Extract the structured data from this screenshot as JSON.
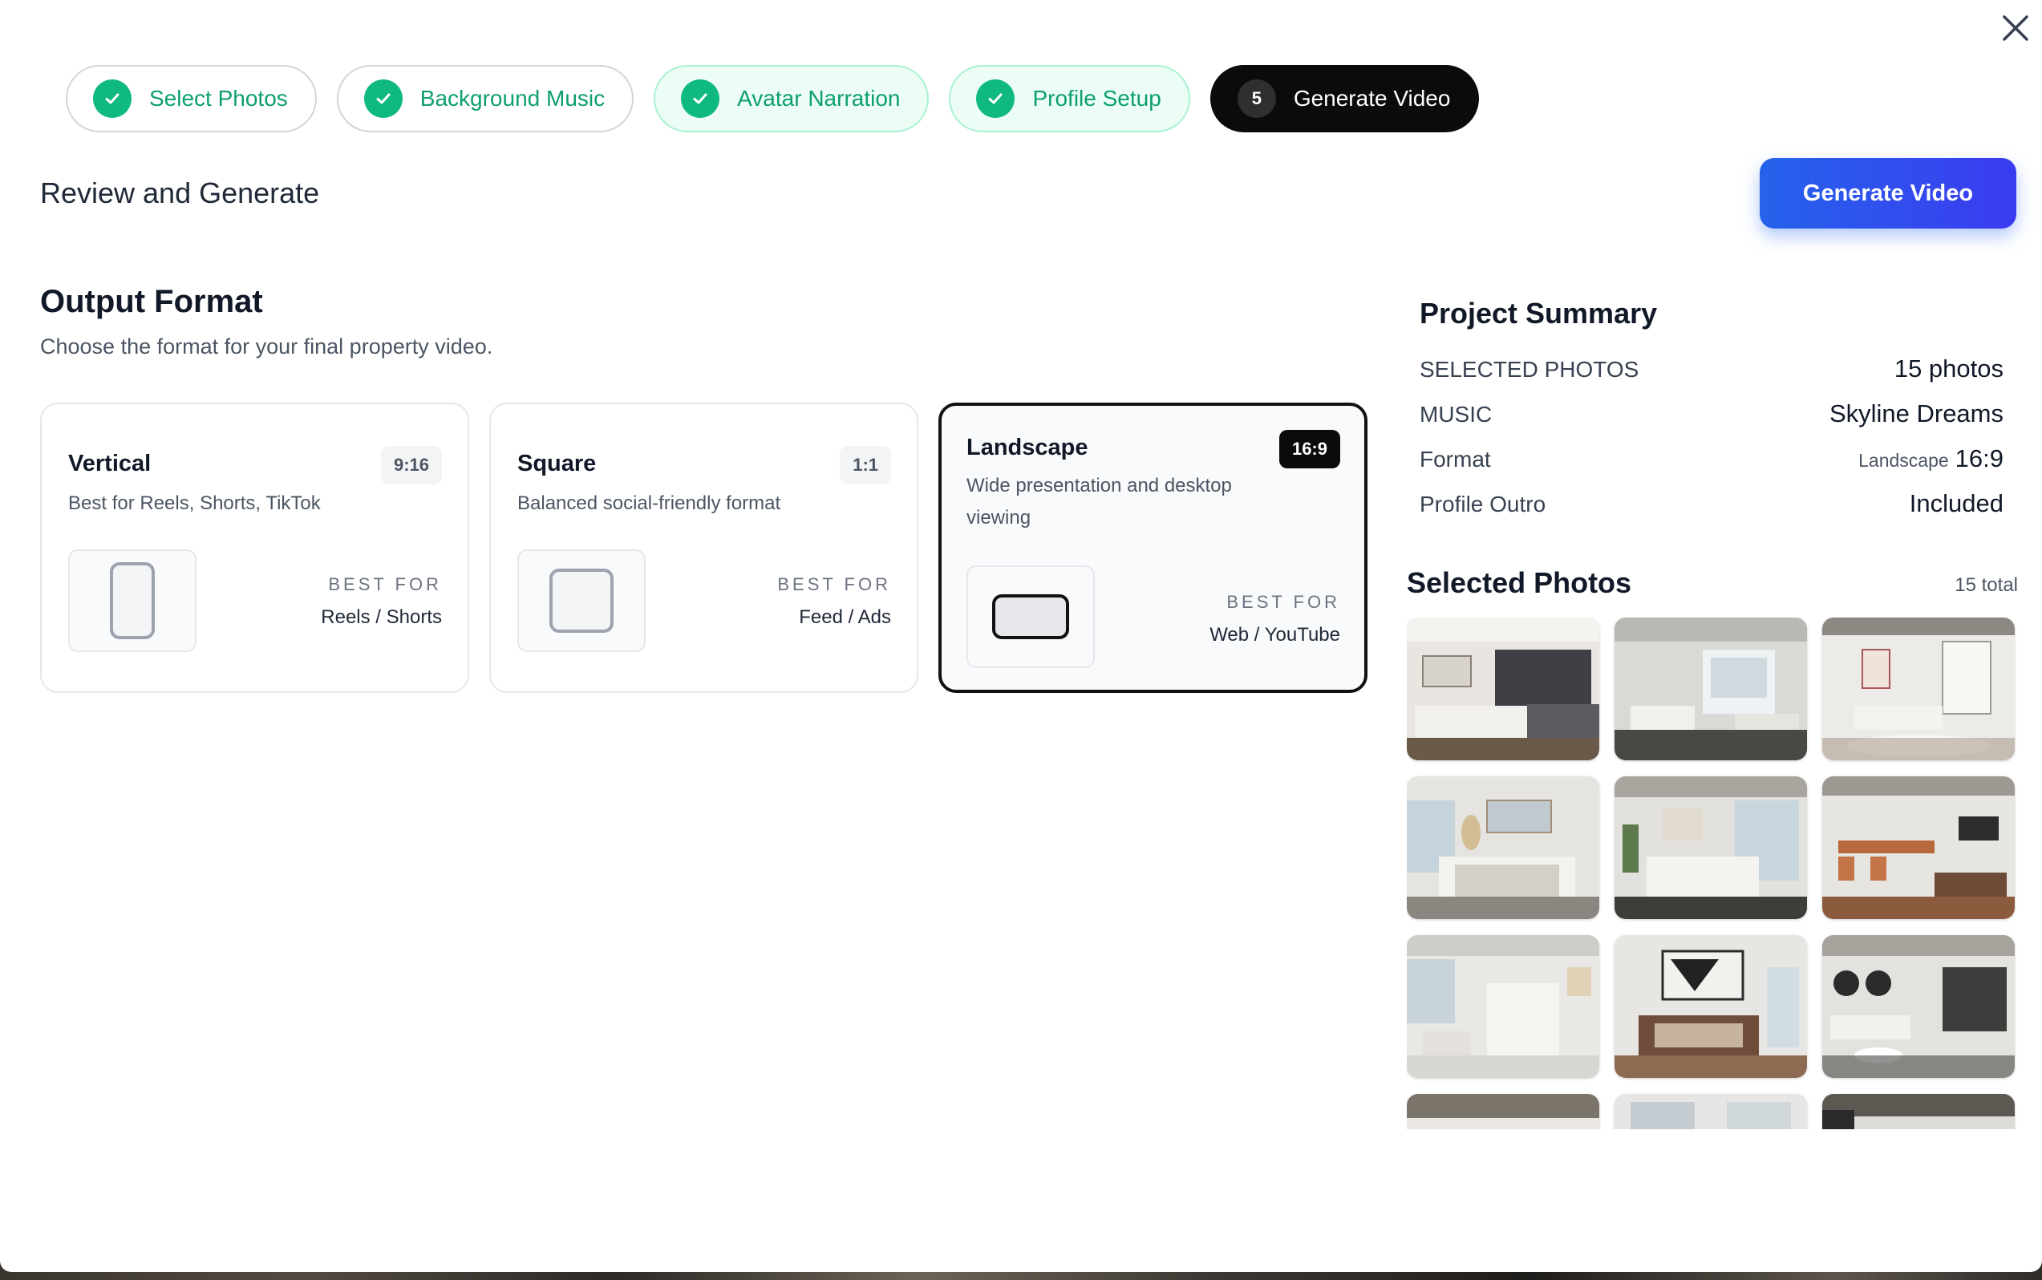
{
  "steps": [
    {
      "label": "Select Photos",
      "state": "done"
    },
    {
      "label": "Background Music",
      "state": "done"
    },
    {
      "label": "Avatar Narration",
      "state": "done"
    },
    {
      "label": "Profile Setup",
      "state": "done"
    },
    {
      "label": "Generate Video",
      "state": "active",
      "number": "5"
    }
  ],
  "header": {
    "title": "Review and Generate",
    "generate_label": "Generate Video"
  },
  "output_format": {
    "title": "Output Format",
    "subtitle": "Choose the format for your final property video.",
    "best_for_label": "BEST FOR",
    "options": [
      {
        "name": "Vertical",
        "ratio": "9:16",
        "description": "Best for Reels, Shorts, TikTok",
        "best_for": "Reels / Shorts",
        "selected": false
      },
      {
        "name": "Square",
        "ratio": "1:1",
        "description": "Balanced social-friendly format",
        "best_for": "Feed / Ads",
        "selected": false
      },
      {
        "name": "Landscape",
        "ratio": "16:9",
        "description": "Wide presentation and desktop viewing",
        "best_for": "Web / YouTube",
        "selected": true
      }
    ]
  },
  "summary": {
    "title": "Project Summary",
    "rows": [
      {
        "key": "SELECTED PHOTOS",
        "value": "15 photos"
      },
      {
        "key": "MUSIC",
        "value": "Skyline Dreams"
      },
      {
        "key": "Format",
        "value_small": "Landscape",
        "value": "16:9"
      },
      {
        "key": "Profile Outro",
        "value": "Included"
      }
    ]
  },
  "selected_photos": {
    "title": "Selected Photos",
    "count": "15 total",
    "photos": [
      {
        "name": "kitchen-photo"
      },
      {
        "name": "living-room-photo"
      },
      {
        "name": "office-photo"
      },
      {
        "name": "bedroom-photo"
      },
      {
        "name": "bedroom-2-photo"
      },
      {
        "name": "dining-photo"
      },
      {
        "name": "kitchen-2-photo"
      },
      {
        "name": "bedroom-3-photo"
      },
      {
        "name": "living-room-2-photo"
      },
      {
        "name": "photo-10"
      },
      {
        "name": "photo-11"
      },
      {
        "name": "photo-12"
      }
    ]
  },
  "colors": {
    "accent_green": "#10b981",
    "primary_blue": "#2563eb",
    "dark": "#0b0b0b"
  },
  "icons": {
    "close": "close-icon",
    "check": "check-icon"
  }
}
